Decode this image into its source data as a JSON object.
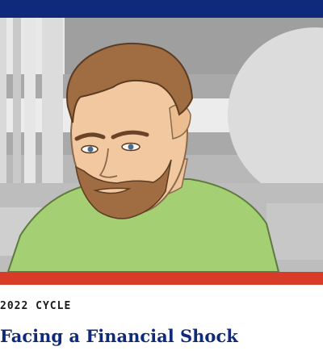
{
  "colors": {
    "top_bar": "#0f2a7a",
    "bottom_bar": "#d83b27",
    "title": "#0f2a7a",
    "label": "#1a1a1a"
  },
  "card": {
    "eyebrow": "2022 CYCLE",
    "title": "Facing a Financial Shock"
  },
  "illustration": {
    "subject": "man-with-beard-green-shirt"
  }
}
